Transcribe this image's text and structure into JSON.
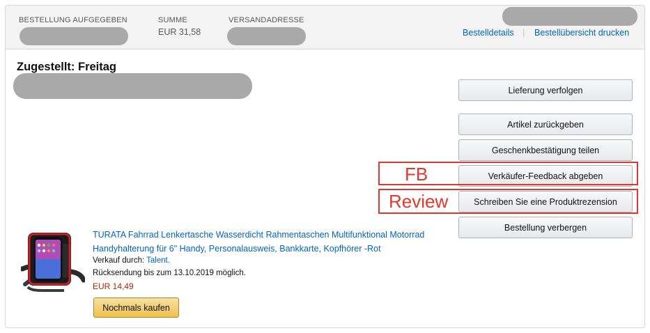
{
  "header": {
    "order_placed_label": "BESTELLUNG AUFGEGEBEN",
    "total_label": "SUMME",
    "total_value": "EUR 31,58",
    "ship_to_label": "VERSANDADRESSE",
    "order_details_link": "Bestelldetails",
    "separator": "|",
    "print_invoice_link": "Bestellübersicht drucken"
  },
  "shipment": {
    "status": "Zugestellt: Freitag"
  },
  "actions": {
    "track": "Lieferung verfolgen",
    "return": "Artikel zurückgeben",
    "gift": "Geschenkbestätigung teilen",
    "seller_feedback": "Verkäufer-Feedback abgeben",
    "review": "Schreiben Sie eine Produktrezension",
    "archive": "Bestellung verbergen"
  },
  "annotations": {
    "fb_label": "FB",
    "review_label": "Review",
    "color": "#e2372c"
  },
  "item": {
    "title": "TURATA Fahrrad Lenkertasche Wasserdicht Rahmentaschen Multifunktional Motorrad Handyhalterung für 6\" Handy, Personalausweis, Bankkarte, Kopfhörer -Rot",
    "sold_by_label": "Verkauf durch:",
    "seller": "Talent.",
    "return_window": "Rücksendung bis zum 13.10.2019 möglich.",
    "price": "EUR 14,49",
    "buy_again": "Nochmals kaufen",
    "image_icon": "phone-bike-mount-icon"
  },
  "colors": {
    "link": "#0066c0",
    "price": "#b12704",
    "header_bg": "#f3f3f3",
    "redaction": "#a9a9a9",
    "buy_button": "#f0c14b"
  }
}
